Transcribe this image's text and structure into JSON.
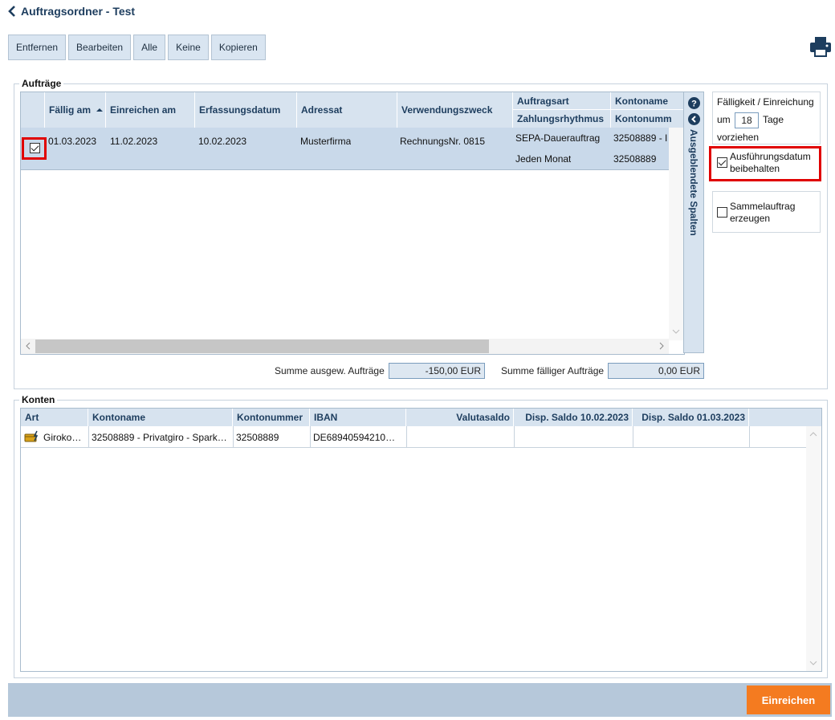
{
  "header": {
    "title": "Auftragsordner - Test"
  },
  "toolbar": {
    "remove": "Entfernen",
    "edit": "Bearbeiten",
    "all": "Alle",
    "none": "Keine",
    "copy": "Kopieren"
  },
  "orders": {
    "legend": "Aufträge",
    "columns": {
      "due": "Fällig am",
      "submit": "Einreichen am",
      "captured": "Erfassungsdatum",
      "addressee": "Adressat",
      "purpose": "Verwendungszweck",
      "order_type": "Auftragsart",
      "rhythm": "Zahlungsrhythmus",
      "account_name": "Kontoname",
      "account_number": "Kontonumm"
    },
    "rows": [
      {
        "checked": true,
        "due": "01.03.2023",
        "submit": "11.02.2023",
        "captured": "10.02.2023",
        "addressee": "Musterfirma",
        "purpose": "RechnungsNr. 0815",
        "order_type": "SEPA-Dauerauftrag",
        "rhythm": "Jeden Monat",
        "account_name": "32508889 - I",
        "account_number": "32508889"
      }
    ],
    "hidden_columns": "Ausgeblendete Spalten",
    "sum_selected_label": "Summe ausgew. Aufträge",
    "sum_selected_value": "-150,00 EUR",
    "sum_due_label": "Summe fälliger Aufträge",
    "sum_due_value": "0,00 EUR"
  },
  "options": {
    "due_title": "Fälligkeit / Einreichung",
    "um": "um",
    "days": "18",
    "tage": "Tage",
    "vorziehen": "vorziehen",
    "keep_date_line1": "Ausführungsdatum",
    "keep_date_line2": "beibehalten",
    "keep_date_checked": true,
    "collective_line1": "Sammelauftrag",
    "collective_line2": "erzeugen",
    "collective_checked": false
  },
  "accounts": {
    "legend": "Konten",
    "columns": {
      "type": "Art",
      "name": "Kontoname",
      "number": "Kontonummer",
      "iban": "IBAN",
      "balance": "Valutasaldo",
      "disp1": "Disp. Saldo 10.02.2023",
      "disp2": "Disp. Saldo 01.03.2023"
    },
    "rows": [
      {
        "type": "Giroko…",
        "name": "32508889 - Privatgiro - Spark…",
        "number": "32508889",
        "iban": "DE68940594210…",
        "balance": "",
        "disp1": "",
        "disp2": ""
      }
    ]
  },
  "footer": {
    "submit": "Einreichen"
  },
  "colors": {
    "accent": "#f47b20",
    "header_bg": "#d7e3ef",
    "selected_row": "#c9d9ea",
    "highlight": "#e00000"
  }
}
